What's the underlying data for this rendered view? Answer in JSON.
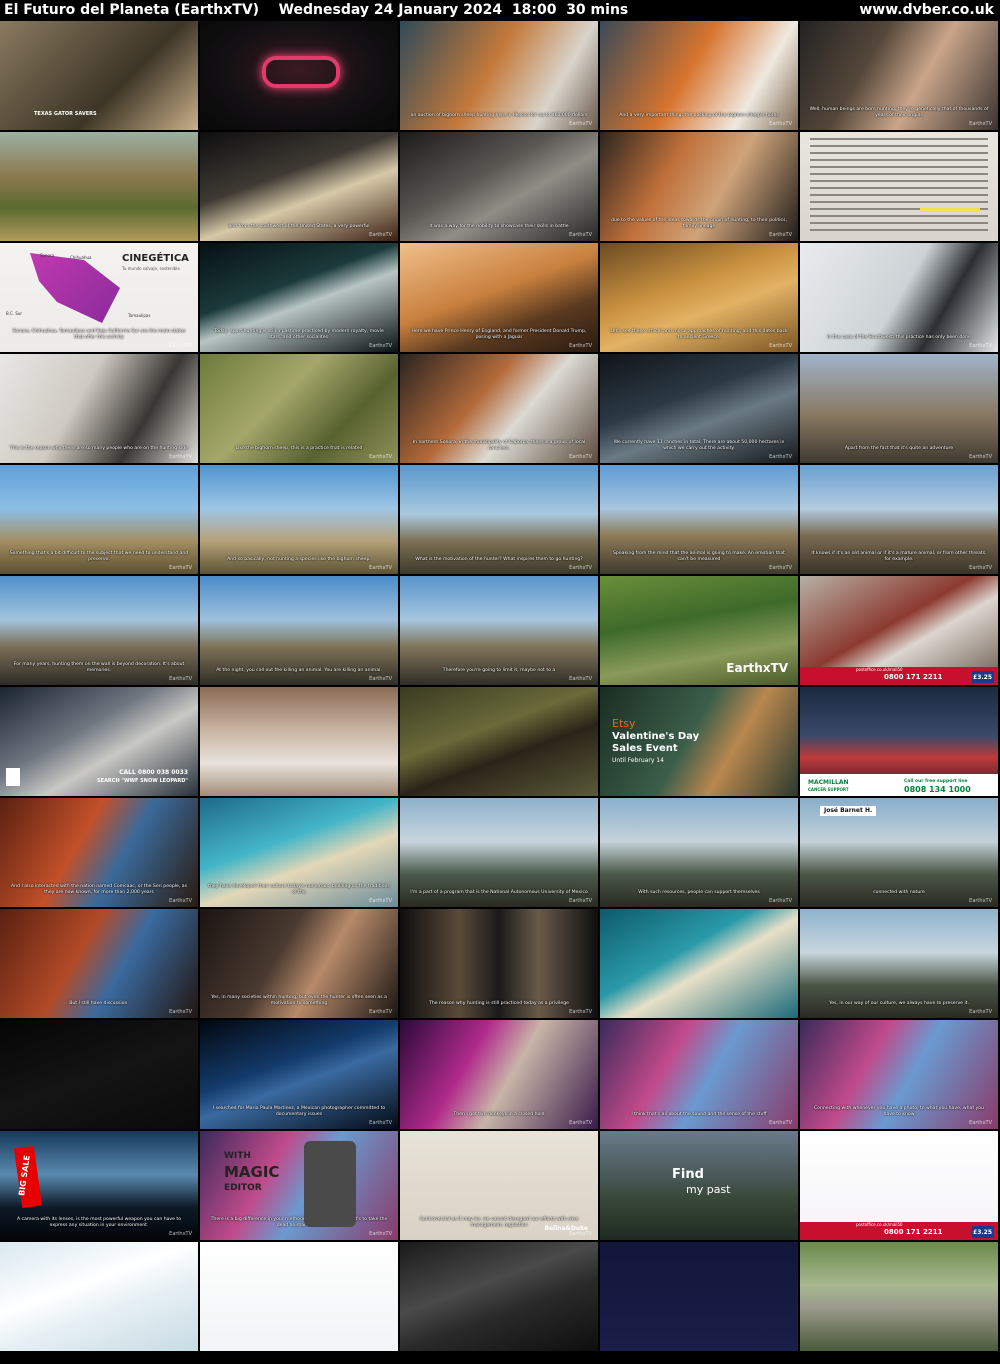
{
  "header": {
    "title": "El Futuro del Planeta (EarthxTV)    Wednesday 24 January 2024  18:00  30 mins",
    "site": "www.dvber.co.uk"
  },
  "watermark": "EarthxTV",
  "thumbs": [
    {
      "bg": "linear-gradient(135deg,#8a7a60,#3d3526 60%,#c9b08a)",
      "cap": ""
    },
    {
      "bg": "radial-gradient(ellipse at 50% 45%,#3a1a22 0%,#121012 55%,#080808)",
      "cap": ""
    },
    {
      "bg": "linear-gradient(120deg,#2f4a5a,#c4793a 45%,#d9d4cc 75%,#6a5a4a)",
      "cap": "an auction of bighorn sheep hunting here in Mexico for up to $60,000 dollars"
    },
    {
      "bg": "linear-gradient(120deg,#3a4a58,#d7742e 45%,#efe9e0 75%,#7a6650)",
      "cap": "And a very important thing: the packing of the bighorn sheep's horns"
    },
    {
      "bg": "linear-gradient(120deg,#222,#55473a 35%,#c9a58a 60%,#3a3330)",
      "cap": "Well, human beings are born hunting, they're genetically that of thousands of years of their origins"
    },
    {
      "bg": "linear-gradient(180deg,#9bb0a3,#8c7a4f 40%,#5b6b2e 70%,#b39a5c)",
      "cap": ""
    },
    {
      "bg": "linear-gradient(160deg,#0e0e10,#3f3a33 40%,#d6c9a8 60%,#3a1f12)",
      "cap": "and from the southwest of the United States, a very powerful"
    },
    {
      "bg": "linear-gradient(150deg,#1b1b1b,#595652 40%,#8f8d86 60%,#262626)",
      "cap": "It was a way for the nobility to showcase their skills in battle"
    },
    {
      "bg": "linear-gradient(120deg,#2b2520,#c0703a 35%,#cfa37a 60%,#1d1b19)",
      "cap": "due to the values of the ideas towards the origin of hunting, to their politics, family lineage"
    },
    {
      "bg": "linear-gradient(180deg,#e9e6df,#d9d5cc)",
      "cap": ""
    },
    {
      "bg": "linear-gradient(180deg,#f4f3f1,#ecebe8)",
      "cap": "Sonora, Chihuahua, Tamaulipas and Baja California Sur are the main states that offer this activity"
    },
    {
      "bg": "linear-gradient(160deg,#061014,#1b3a3b 40%,#b9c5c5 55%,#0a1213)",
      "cap": "Today, sport hunting is still a pastime practiced by modern royalty, movie stars, and other socialites."
    },
    {
      "bg": "linear-gradient(160deg,#f0c08a,#c9803e 45%,#5a3a20 70%,#2a1a10)",
      "cap": "Here we have Prince Henry of England, and former President Donald Trump, posing with a Jaguar"
    },
    {
      "bg": "linear-gradient(160deg,#6b4a22,#c9913f 40%,#e2b264 60%,#7a5524)",
      "cap": "Let's see these ethical and moral approaches of hunting, and this dates back to ancient Greece."
    },
    {
      "bg": "linear-gradient(120deg,#e9ecee,#cdd3d6 50%,#2b2f33 70%,#e6e8ea)",
      "cap": "In the case of the Southwest, this practice has only been done"
    },
    {
      "bg": "linear-gradient(120deg,#e7e7e5,#cfcac2 40%,#3a3633 70%,#e0ded9)",
      "cap": "This is the reason why there are so many people who are on the hunting side"
    },
    {
      "bg": "linear-gradient(135deg,#6b7a3a,#a5a76a 40%,#586230 70%,#8f9158)",
      "cap": "Like the bighorn sheep, this is a practice that is related"
    },
    {
      "bg": "linear-gradient(130deg,#2a2320,#b36a3a 40%,#dcdad4 60%,#5a4a3a)",
      "cap": "In northern Sonora, in the municipality of Caborca, there is a group of local ranchers."
    },
    {
      "bg": "linear-gradient(160deg,#101418,#2c3a45 40%,#6a7a84 60%,#15191c)",
      "cap": "We currently have 11 ranches in total. There are about 50,000 hectares in which we carry out the activity."
    },
    {
      "bg": "linear-gradient(180deg,#9fb3c9,#8a7a64 55%,#3f3a30)",
      "cap": "Apart from the fact that it's quite an adventure"
    },
    {
      "bg": "linear-gradient(180deg,#5fa0d9,#8cbfe6 40%,#a48e62 70%,#5a5030)",
      "cap": "Something that's a bit difficult to the subject that we need to understand and preserve."
    },
    {
      "bg": "linear-gradient(180deg,#4e93cf,#9fc6e5 40%,#b5a078 70%,#5b5334)",
      "cap": "And so basically, not hunting a species like the bighorn sheep."
    },
    {
      "bg": "linear-gradient(180deg,#5a97cd,#a8c8de 45%,#7d7054 70%,#3a3a2a)",
      "cap": "What is the motivation of the hunter? What inspires them to go hunting?"
    },
    {
      "bg": "linear-gradient(180deg,#5e9ad4,#a8c6df 40%,#8d7a58 65%,#3f3a2c)",
      "cap": "Speaking from the mind that the animal is going to make. An emotion that can't be measured"
    },
    {
      "bg": "linear-gradient(180deg,#6a9fd1,#b3cbe0 40%,#7a6a52 65%,#3a3428)",
      "cap": "It knows if it's an old animal or if it's a mature animal, or from other threats, for example."
    },
    {
      "bg": "linear-gradient(180deg,#4f8fca,#a3c4de 40%,#7a6e57 65%,#2e2c25)",
      "cap": "For many years, hunting them on the wall is beyond decoration. It's about memories."
    },
    {
      "bg": "linear-gradient(180deg,#4a8bc8,#9ec1dd 40%,#7e7358 65%,#2f2d26)",
      "cap": "At the night, you call out the killing an animal. You are killing an animal."
    },
    {
      "bg": "linear-gradient(180deg,#5894cc,#a6c5de 40%,#80745a 65%,#302e27)",
      "cap": "Therefore you're going to limit it, maybe not to a"
    },
    {
      "bg": "linear-gradient(170deg,#6a8f3a,#3e6a2a 40%,#8a9a5a 70%,#4a5a2a)",
      "cap": ""
    },
    {
      "bg": "linear-gradient(150deg,#b8b0a4,#8c3a30 45%,#dcd6cf 60%,#6a5a4e)",
      "cap": ""
    },
    {
      "bg": "linear-gradient(150deg,#1a2430,#6e7680 40%,#c9c8c4 60%,#27313b)",
      "cap": ""
    },
    {
      "bg": "linear-gradient(180deg,#8a6b55,#c9b5a3 40%,#e8e2dc 70%,#a48c78)",
      "cap": ""
    },
    {
      "bg": "linear-gradient(160deg,#3a3a22,#6a6a3a 40%,#2a2418 60%,#5a5a38)",
      "cap": ""
    },
    {
      "bg": "linear-gradient(120deg,#1a2d22,#3b5e4a 45%,#b9874e 65%,#2a3a30)",
      "cap": ""
    },
    {
      "bg": "linear-gradient(180deg,#1a2a40,#3a4a6a 45%,#c03a3a 65%,#0e1a2a)",
      "cap": ""
    },
    {
      "bg": "linear-gradient(120deg,#5a2010,#c2502a 40%,#3a6a9a 60%,#2a1a10)",
      "cap": "And I also interacted with the nation named Comcaac, or the Seri people, as they are now known, for more than 2,000 years"
    },
    {
      "bg": "linear-gradient(160deg,#1e6a8a,#44b5c8 40%,#e3d8b8 60%,#6a8a9a)",
      "cap": "they have developed their culture today's numerous, building on the traditions of the"
    },
    {
      "bg": "linear-gradient(180deg,#8fb1cc,#c8d5de 40%,#4a5a4a 70%,#2a2a22)",
      "cap": "I'm a part of a program that is the National Autonomous University of Mexico"
    },
    {
      "bg": "linear-gradient(180deg,#8ab0cc,#c5d2da 40%,#4a5848 70%,#2a2a22)",
      "cap": "With such resources, people can support themselves"
    },
    {
      "bg": "linear-gradient(180deg,#88aecb,#c3d1d9 40%,#4a5646 70%,#2a2a22)",
      "cap": "connected with nature"
    },
    {
      "bg": "linear-gradient(120deg,#5a2010,#b24a28 40%,#3a6aa0 60%,#22150e)",
      "cap": "But I still have discussion."
    },
    {
      "bg": "linear-gradient(120deg,#1a1412,#4a3a30 40%,#b78a6a 60%,#1a1512)",
      "cap": "Yes, in many societies within hunting, but even the hunter is often seen as a motivation to something"
    },
    {
      "bg": "linear-gradient(90deg,#0e0e0e,#5a4a3a 30%,#1a1a1a 50%,#6a5a4a 70%,#0e0e0e)",
      "cap": "The reason why hunting is still practiced today as a privilege"
    },
    {
      "bg": "linear-gradient(150deg,#0e5a6a,#2a9aa8 40%,#e8e0c8 55%,#1a6a7a)",
      "cap": ""
    },
    {
      "bg": "linear-gradient(180deg,#8fb3cd,#c8d6de 40%,#4a5646 70%,#2a2a22)",
      "cap": "Yes, in our way of our culture, we always have to preserve it."
    },
    {
      "bg": "linear-gradient(160deg,#050505,#141414 50%,#0a0a0a)",
      "cap": ""
    },
    {
      "bg": "linear-gradient(160deg,#03070f,#123a6a 40%,#3a6aa0 55%,#050a14)",
      "cap": "I searched for Maria Paula Martinez, a Mexican photographer committed to documentary issues"
    },
    {
      "bg": "linear-gradient(120deg,#2a0a3a,#b02a8a 35%,#c8b5a8 55%,#3a1a4a)",
      "cap": "Then I got two donkeys in a closed hold"
    },
    {
      "bg": "linear-gradient(120deg,#3a2a5a,#c24a8a 35%,#6a9ad0 55%,#8a3a6a)",
      "cap": "I think that's all about the sound and the sense of the stuff"
    },
    {
      "bg": "linear-gradient(120deg,#3a2a5a,#c04a8a 35%,#6a9ad0 55%,#8a3a6a)",
      "cap": "Connecting with whenever you have a photo, to what you have, what you have to know"
    },
    {
      "bg": "linear-gradient(180deg,#14385a,#5a8ab0 40%,#0e1a28 70%,#020508)",
      "cap": "A camera with its lenses, is the most powerful weapon you can have to express any situation in your environment."
    },
    {
      "bg": "linear-gradient(120deg,#3a2a5a,#c04a8a 35%,#6a9ad0 55%,#8a3a6a)",
      "cap": "There is a big difference in your methodology at the moment, it's to take the dead animal home."
    },
    {
      "bg": "linear-gradient(180deg,#e8e3d8,#d9d2c4)",
      "cap": "Controversial as it may be, we cannot disregard our efforts with wise management, regulation"
    },
    {
      "bg": "linear-gradient(180deg,#6a7a8a,#4a5a5a 40%,#3a4a3a 60%,#1e2a22)",
      "cap": ""
    },
    {
      "bg": "linear-gradient(180deg,#ffffff,#f5f3f6)",
      "cap": ""
    },
    {
      "bg": "linear-gradient(160deg,#d8e8f0,#ffffff 40%,#e6f0f4 60%,#c8dbe4)",
      "cap": ""
    },
    {
      "bg": "linear-gradient(180deg,#ffffff,#f2f4f5)",
      "cap": ""
    },
    {
      "bg": "linear-gradient(160deg,#1a1a1a,#4a4a4a 40%,#2a2a2a 60%,#0e0e0e)",
      "cap": ""
    },
    {
      "bg": "linear-gradient(180deg,#12163a,#1a1e48)",
      "cap": ""
    },
    {
      "bg": "linear-gradient(180deg,#6a8a4a,#a8b890 40%,#9a9a8a 60%,#4a5a3a)",
      "cap": ""
    }
  ],
  "overlays": {
    "t0": "TEXAS GATOR SAVERS",
    "t10_title": "CINEGÉTICA",
    "t10_sub": "Tu mundo salvaje, sostenible",
    "t10_states": [
      "Sonora",
      "Chihuahua",
      "B.C. Sur",
      "Tamaulipas"
    ],
    "t23_brand": "EarthxTV",
    "t24_phone": "0800 171 2211",
    "t24_price": "£3.25",
    "t24_url": "postoffice.co.uk/mail50",
    "t25_phone": "CALL 0800 038 0033",
    "t25_text": "SEARCH \"WWF SNOW LEOPARD\"",
    "t28_brand": "Etsy",
    "t28_line1": "Valentine's Day",
    "t28_line2": "Sales Event",
    "t28_line3": "Until February 14",
    "t29_brand": "MACMILLAN",
    "t29_brand_sub": "CANCER SUPPORT",
    "t29_top": "Call our free support line",
    "t29_phone": "0808 134 1000",
    "t34_name": "José Barnet H.",
    "t51_bigsale": "BIG SALE",
    "t52_line1": "WITH",
    "t52_line2": "MAGIC",
    "t52_line3": "EDITOR",
    "t53_brand": "Bellna&Duke",
    "t54_logo1": "Find",
    "t54_logo2": "my past",
    "t55_phone": "0800 171 2211",
    "t55_price": "£3.25",
    "t55_url": "postoffice.co.uk/mail50"
  }
}
